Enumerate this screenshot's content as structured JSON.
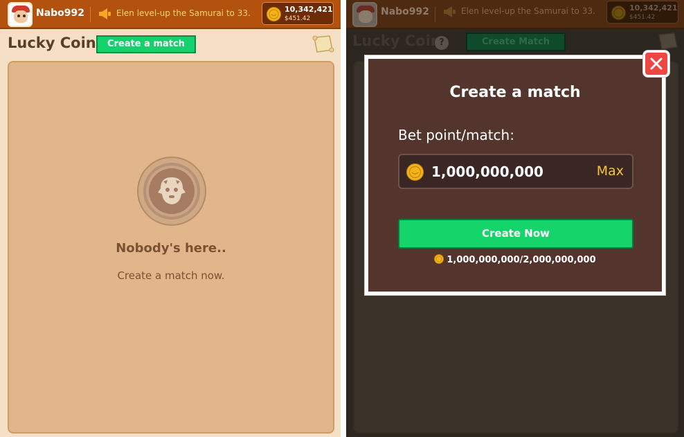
{
  "left": {
    "topbar": {
      "username": "Nabo992",
      "announcement": "Elen level-up the Samurai to 33...",
      "balance_amount": "10,342,421",
      "balance_usd": "$451.42"
    },
    "header": {
      "title": "Lucky Coin",
      "create_button": "Create a match"
    },
    "empty_state": {
      "heading": "Nobody's here..",
      "subtext": "Create a match now."
    }
  },
  "right": {
    "topbar": {
      "username": "Nabo992",
      "announcement": "Elen level-up the Samurai to 33...",
      "balance_amount": "10,342,421",
      "balance_usd": "$451.42"
    },
    "header": {
      "title": "Lucky Coin",
      "help_icon_glyph": "?",
      "create_button": "Create  Match"
    },
    "modal": {
      "title": "Create a match",
      "bet_label": "Bet point/match:",
      "bet_value": "1,000,000,000",
      "max_button": "Max",
      "create_button": "Create Now",
      "limit": "1,000,000,000/2,000,000,000"
    }
  },
  "colors": {
    "topbar": "#b3510f",
    "page_bg": "#f5dfc5",
    "panel_bg": "#e2b68b",
    "primary_green": "#13d26b",
    "modal_bg": "#54352d",
    "close_red": "#ee4642",
    "coin_gold": "#f2b31b"
  },
  "icons": [
    "avatar",
    "megaphone-icon",
    "coin-icon",
    "scroll-icon",
    "help-icon",
    "close-icon",
    "empty-coin-icon"
  ]
}
